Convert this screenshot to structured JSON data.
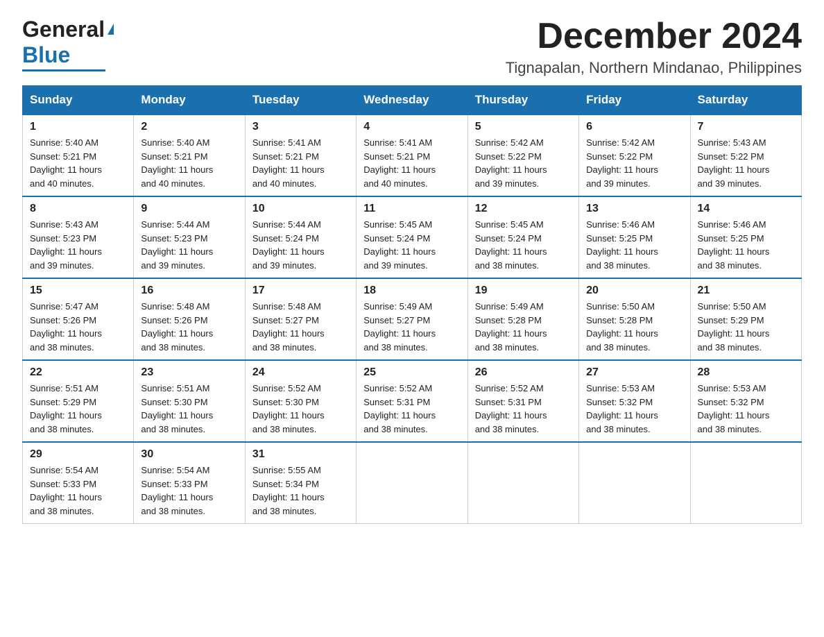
{
  "logo": {
    "general": "General",
    "blue": "Blue"
  },
  "header": {
    "month": "December 2024",
    "location": "Tignapalan, Northern Mindanao, Philippines"
  },
  "days_of_week": [
    "Sunday",
    "Monday",
    "Tuesday",
    "Wednesday",
    "Thursday",
    "Friday",
    "Saturday"
  ],
  "weeks": [
    [
      {
        "day": "1",
        "sunrise": "5:40 AM",
        "sunset": "5:21 PM",
        "daylight": "11 hours and 40 minutes."
      },
      {
        "day": "2",
        "sunrise": "5:40 AM",
        "sunset": "5:21 PM",
        "daylight": "11 hours and 40 minutes."
      },
      {
        "day": "3",
        "sunrise": "5:41 AM",
        "sunset": "5:21 PM",
        "daylight": "11 hours and 40 minutes."
      },
      {
        "day": "4",
        "sunrise": "5:41 AM",
        "sunset": "5:21 PM",
        "daylight": "11 hours and 40 minutes."
      },
      {
        "day": "5",
        "sunrise": "5:42 AM",
        "sunset": "5:22 PM",
        "daylight": "11 hours and 39 minutes."
      },
      {
        "day": "6",
        "sunrise": "5:42 AM",
        "sunset": "5:22 PM",
        "daylight": "11 hours and 39 minutes."
      },
      {
        "day": "7",
        "sunrise": "5:43 AM",
        "sunset": "5:22 PM",
        "daylight": "11 hours and 39 minutes."
      }
    ],
    [
      {
        "day": "8",
        "sunrise": "5:43 AM",
        "sunset": "5:23 PM",
        "daylight": "11 hours and 39 minutes."
      },
      {
        "day": "9",
        "sunrise": "5:44 AM",
        "sunset": "5:23 PM",
        "daylight": "11 hours and 39 minutes."
      },
      {
        "day": "10",
        "sunrise": "5:44 AM",
        "sunset": "5:24 PM",
        "daylight": "11 hours and 39 minutes."
      },
      {
        "day": "11",
        "sunrise": "5:45 AM",
        "sunset": "5:24 PM",
        "daylight": "11 hours and 39 minutes."
      },
      {
        "day": "12",
        "sunrise": "5:45 AM",
        "sunset": "5:24 PM",
        "daylight": "11 hours and 38 minutes."
      },
      {
        "day": "13",
        "sunrise": "5:46 AM",
        "sunset": "5:25 PM",
        "daylight": "11 hours and 38 minutes."
      },
      {
        "day": "14",
        "sunrise": "5:46 AM",
        "sunset": "5:25 PM",
        "daylight": "11 hours and 38 minutes."
      }
    ],
    [
      {
        "day": "15",
        "sunrise": "5:47 AM",
        "sunset": "5:26 PM",
        "daylight": "11 hours and 38 minutes."
      },
      {
        "day": "16",
        "sunrise": "5:48 AM",
        "sunset": "5:26 PM",
        "daylight": "11 hours and 38 minutes."
      },
      {
        "day": "17",
        "sunrise": "5:48 AM",
        "sunset": "5:27 PM",
        "daylight": "11 hours and 38 minutes."
      },
      {
        "day": "18",
        "sunrise": "5:49 AM",
        "sunset": "5:27 PM",
        "daylight": "11 hours and 38 minutes."
      },
      {
        "day": "19",
        "sunrise": "5:49 AM",
        "sunset": "5:28 PM",
        "daylight": "11 hours and 38 minutes."
      },
      {
        "day": "20",
        "sunrise": "5:50 AM",
        "sunset": "5:28 PM",
        "daylight": "11 hours and 38 minutes."
      },
      {
        "day": "21",
        "sunrise": "5:50 AM",
        "sunset": "5:29 PM",
        "daylight": "11 hours and 38 minutes."
      }
    ],
    [
      {
        "day": "22",
        "sunrise": "5:51 AM",
        "sunset": "5:29 PM",
        "daylight": "11 hours and 38 minutes."
      },
      {
        "day": "23",
        "sunrise": "5:51 AM",
        "sunset": "5:30 PM",
        "daylight": "11 hours and 38 minutes."
      },
      {
        "day": "24",
        "sunrise": "5:52 AM",
        "sunset": "5:30 PM",
        "daylight": "11 hours and 38 minutes."
      },
      {
        "day": "25",
        "sunrise": "5:52 AM",
        "sunset": "5:31 PM",
        "daylight": "11 hours and 38 minutes."
      },
      {
        "day": "26",
        "sunrise": "5:52 AM",
        "sunset": "5:31 PM",
        "daylight": "11 hours and 38 minutes."
      },
      {
        "day": "27",
        "sunrise": "5:53 AM",
        "sunset": "5:32 PM",
        "daylight": "11 hours and 38 minutes."
      },
      {
        "day": "28",
        "sunrise": "5:53 AM",
        "sunset": "5:32 PM",
        "daylight": "11 hours and 38 minutes."
      }
    ],
    [
      {
        "day": "29",
        "sunrise": "5:54 AM",
        "sunset": "5:33 PM",
        "daylight": "11 hours and 38 minutes."
      },
      {
        "day": "30",
        "sunrise": "5:54 AM",
        "sunset": "5:33 PM",
        "daylight": "11 hours and 38 minutes."
      },
      {
        "day": "31",
        "sunrise": "5:55 AM",
        "sunset": "5:34 PM",
        "daylight": "11 hours and 38 minutes."
      },
      null,
      null,
      null,
      null
    ]
  ],
  "labels": {
    "sunrise": "Sunrise: ",
    "sunset": "Sunset: ",
    "daylight": "Daylight: "
  }
}
